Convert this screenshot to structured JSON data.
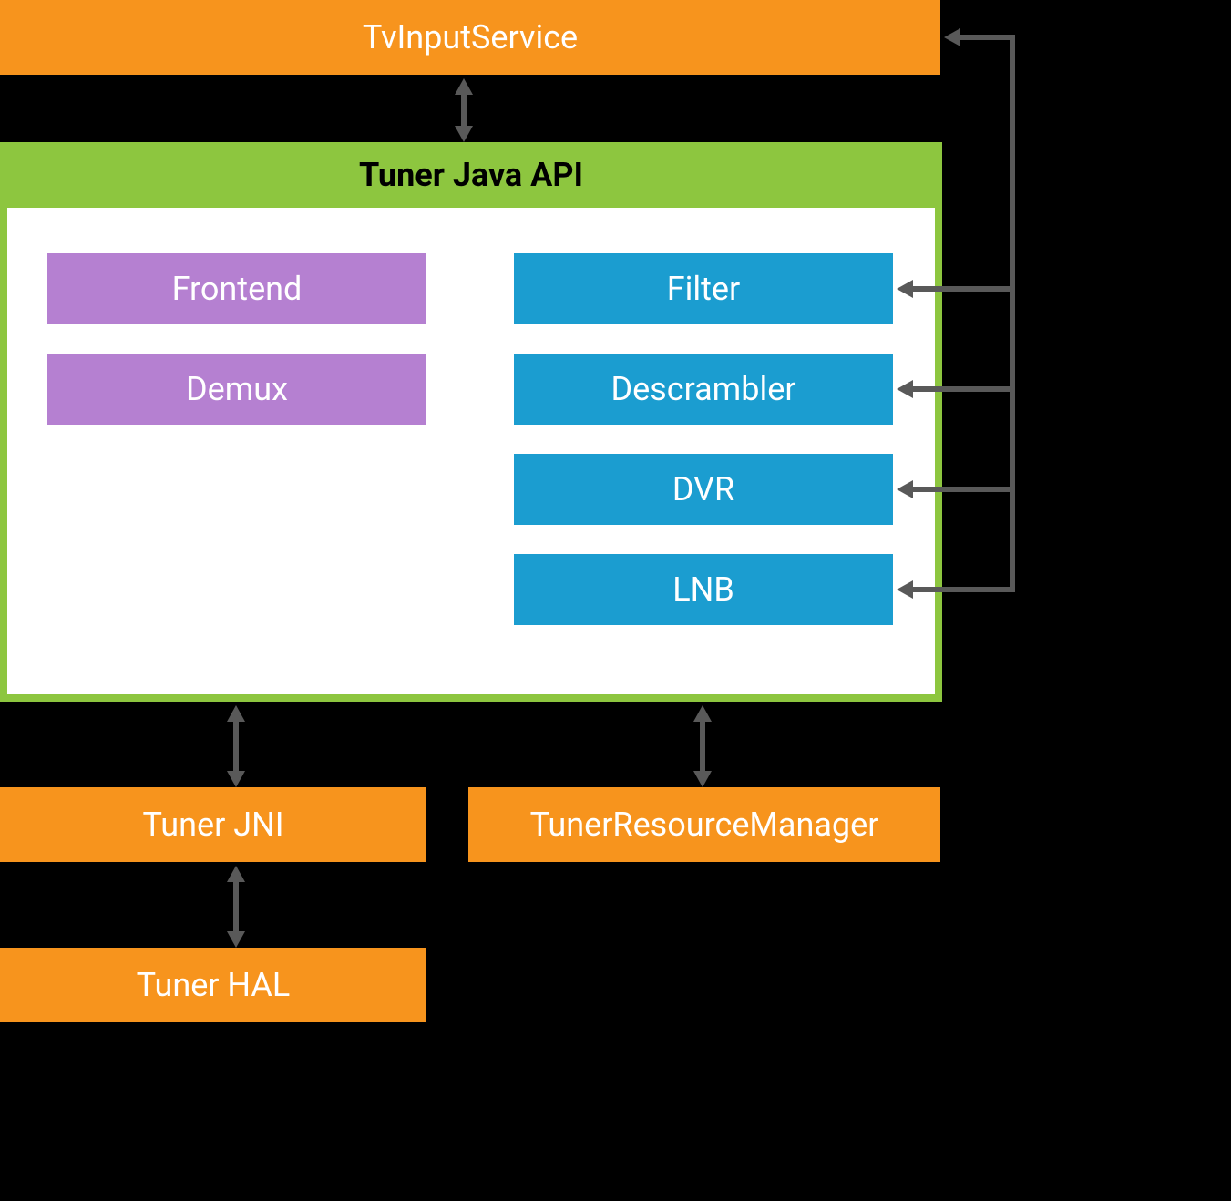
{
  "top": {
    "tv_input_service": "TvInputService"
  },
  "api_container": {
    "title": "Tuner Java API",
    "left": {
      "frontend": "Frontend",
      "demux": "Demux"
    },
    "right": {
      "filter": "Filter",
      "descrambler": "Descrambler",
      "dvr": "DVR",
      "lnb": "LNB"
    }
  },
  "bottom": {
    "tuner_jni": "Tuner JNI",
    "tuner_resource_manager": "TunerResourceManager",
    "tuner_hal": "Tuner HAL"
  }
}
